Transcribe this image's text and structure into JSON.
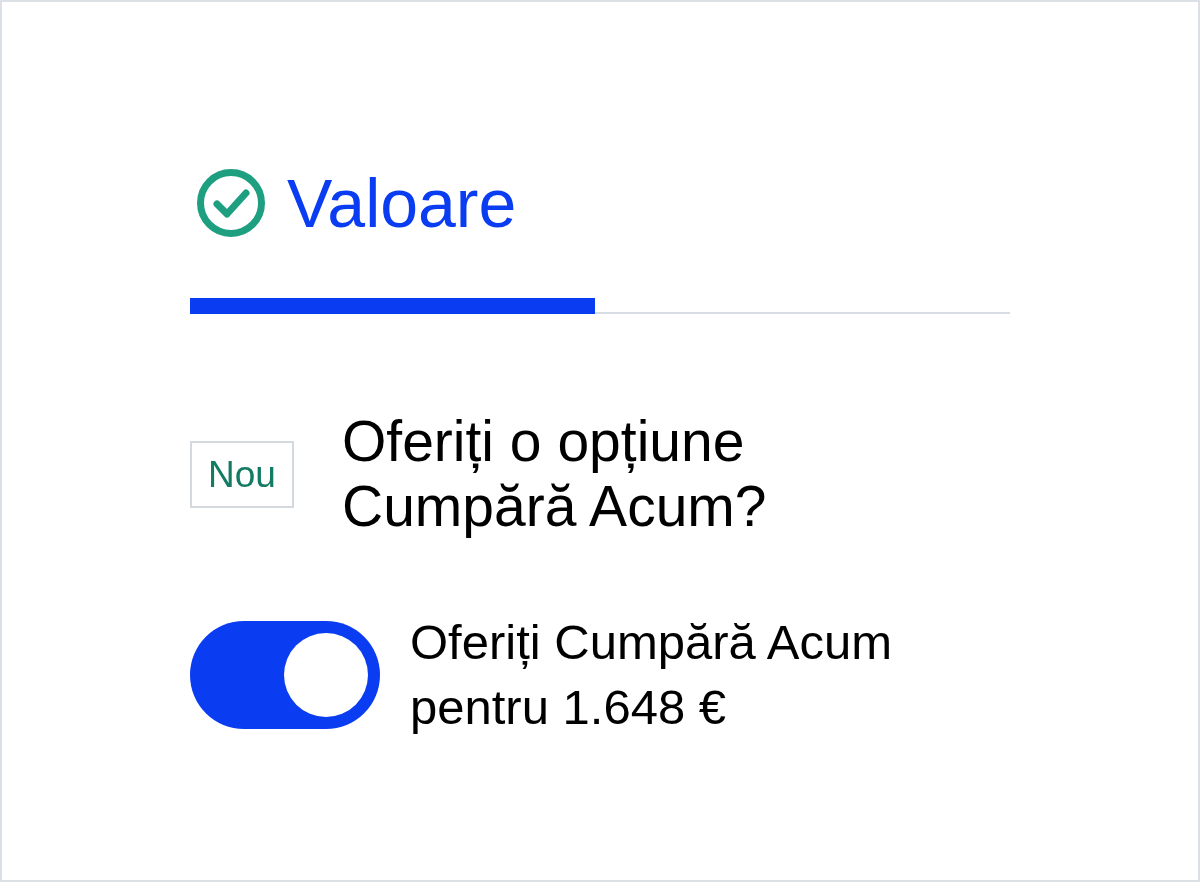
{
  "header": {
    "title": "Valoare",
    "done": true
  },
  "progress": {
    "level": 0.494
  },
  "question": {
    "badge": "Nou",
    "text": "Oferiți o opțiune Cumpără Acum?"
  },
  "toggle": {
    "on": true,
    "label": "Oferiți Cumpără Acum pentru 1.648 €"
  }
}
